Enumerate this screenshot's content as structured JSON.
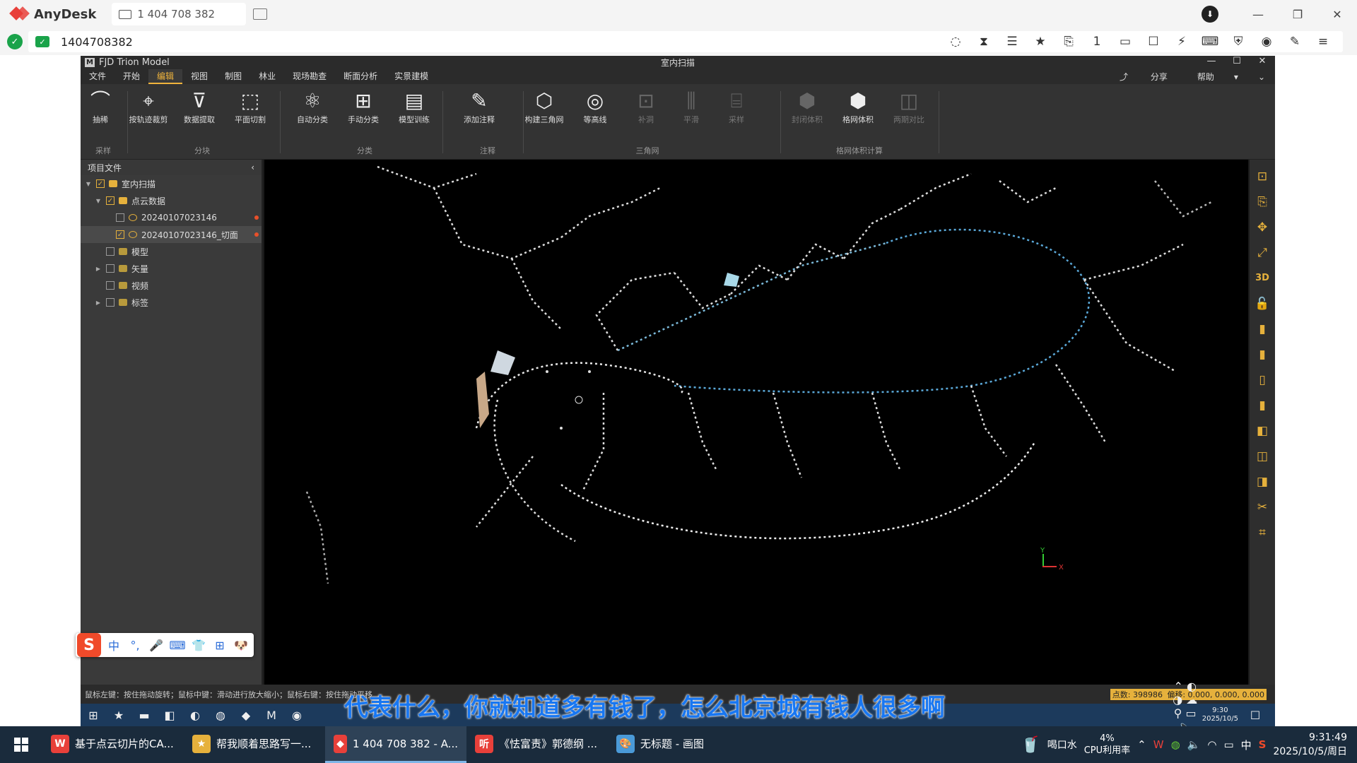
{
  "anydesk": {
    "app_name": "AnyDesk",
    "tab_label": "1 404 708 382",
    "address": "1404708382",
    "toolbar_icons": [
      "eye-off-icon",
      "hourglass-icon",
      "database-icon",
      "star-icon",
      "file-transfer-icon",
      "monitor-1-icon",
      "display-icon",
      "chat-icon",
      "action-icon",
      "keyboard-icon",
      "shield-icon",
      "record-icon",
      "pen-icon",
      "menu-icon"
    ],
    "monitor_badge": "1"
  },
  "app": {
    "title": "FJD Trion Model",
    "window_title": "室内扫描",
    "menu": [
      "文件",
      "开始",
      "编辑",
      "视图",
      "制图",
      "林业",
      "现场勘查",
      "断面分析",
      "实景建模"
    ],
    "active_menu": "编辑",
    "share": "分享",
    "help": "帮助",
    "ribbon": [
      {
        "label": "抽稀",
        "glyph": "⌒",
        "enabled": true
      },
      {
        "label": "按轨迹裁剪",
        "glyph": "⌖",
        "enabled": true
      },
      {
        "label": "数据提取",
        "glyph": "⊽",
        "enabled": true
      },
      {
        "label": "平面切割",
        "glyph": "⬚",
        "enabled": true
      },
      {
        "label": "自动分类",
        "glyph": "⚛",
        "enabled": true
      },
      {
        "label": "手动分类",
        "glyph": "⊞",
        "enabled": true
      },
      {
        "label": "模型训练",
        "glyph": "▤",
        "enabled": true
      },
      {
        "label": "添加注释",
        "glyph": "✎",
        "enabled": true
      },
      {
        "label": "构建三角网",
        "glyph": "⬡",
        "enabled": true
      },
      {
        "label": "等高线",
        "glyph": "◎",
        "enabled": true
      },
      {
        "label": "补洞",
        "glyph": "⊡",
        "enabled": false
      },
      {
        "label": "平滑",
        "glyph": "⫼",
        "enabled": false
      },
      {
        "label": "采样",
        "glyph": "⌸",
        "enabled": false
      },
      {
        "label": "封闭体积",
        "glyph": "⬢",
        "enabled": false
      },
      {
        "label": "格网体积",
        "glyph": "⬢",
        "enabled": true
      },
      {
        "label": "两期对比",
        "glyph": "◫",
        "enabled": false
      }
    ],
    "groups": [
      "采样",
      "分块",
      "分类",
      "注释",
      "三角网",
      "格网体积计算"
    ],
    "panel_title": "项目文件",
    "tree": [
      {
        "label": "室内扫描",
        "level": 0,
        "checked": true,
        "expanded": true
      },
      {
        "label": "点云数据",
        "level": 1,
        "checked": true,
        "expanded": true
      },
      {
        "label": "20240107023146",
        "level": 2,
        "checked": false
      },
      {
        "label": "20240107023146_切面",
        "level": 2,
        "checked": true
      },
      {
        "label": "模型",
        "level": 1,
        "checked": false
      },
      {
        "label": "矢量",
        "level": 1,
        "checked": false
      },
      {
        "label": "视频",
        "level": 1,
        "checked": false
      },
      {
        "label": "标签",
        "level": 1,
        "checked": false
      }
    ],
    "right_tools": [
      "⊡",
      "⎘",
      "✥",
      "⤢",
      "3D",
      "🔓",
      "▮",
      "▮",
      "▯",
      "▮",
      "◧",
      "◫",
      "◨",
      "✂",
      "⌗"
    ],
    "status_text": "鼠标左键：按住拖动旋转；鼠标中键：滑动进行放大缩小；鼠标右键：按住拖动平移",
    "points": "点数: 398986",
    "offset": "偏移: 0.000, 0.000, 0.000",
    "axis_y": "Y",
    "axis_x": "X"
  },
  "remote_taskbar": {
    "clock_time": "9:30",
    "clock_date": "2025/10/5"
  },
  "ime": {
    "items": [
      "中",
      "°,",
      "🎤",
      "⌨",
      "👕",
      "⊞",
      "🐶"
    ]
  },
  "subtitle": "代表什么，你就知道多有钱了，怎么北京城有钱人很多啊",
  "taskbar": {
    "items": [
      {
        "label": "基于点云切片的CA...",
        "color": "#e8403a",
        "glyph": "W"
      },
      {
        "label": "帮我顺着思路写一...",
        "color": "#e6b13c",
        "glyph": "★"
      },
      {
        "label": "1 404 708 382 - A...",
        "color": "#e8403a",
        "glyph": "◆",
        "active": true
      },
      {
        "label": "《怯富责》郭德纲 ...",
        "color": "#e8403a",
        "glyph": "听"
      },
      {
        "label": "无标题 - 画图",
        "color": "#4a9ad8",
        "glyph": "🎨"
      }
    ],
    "drink": "喝口水",
    "cpu_pct": "4%",
    "cpu_label": "CPU利用率",
    "ime": "中",
    "time": "9:31:49",
    "date": "2025/10/5/周日"
  }
}
